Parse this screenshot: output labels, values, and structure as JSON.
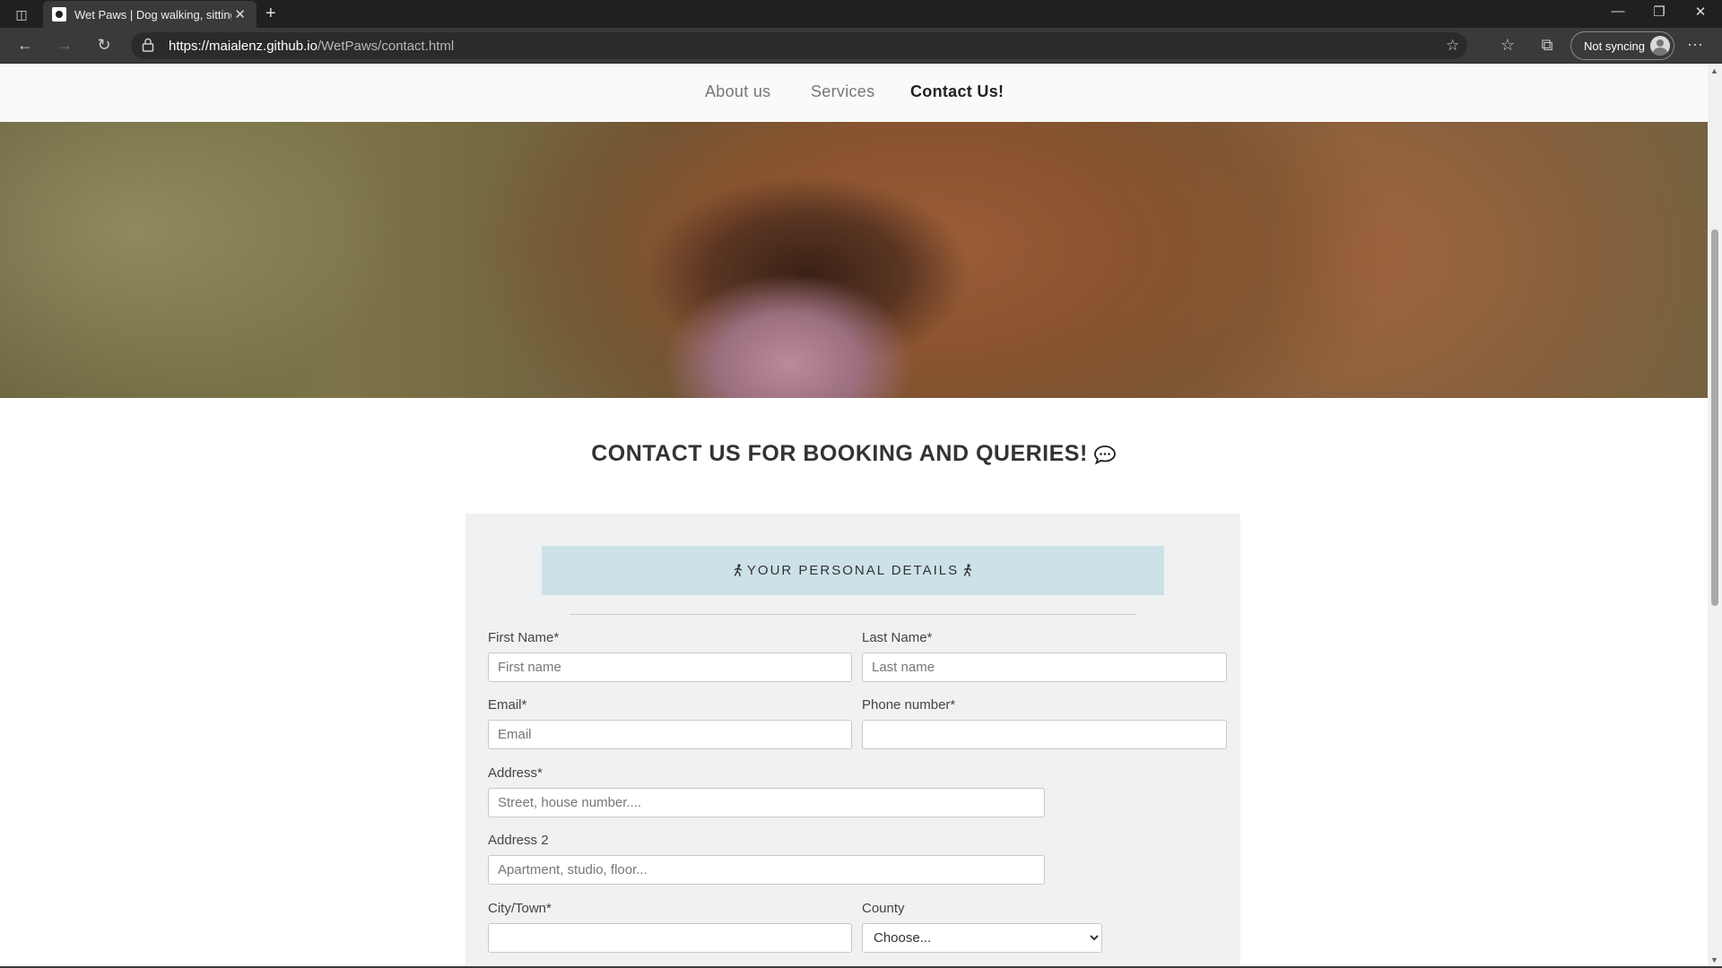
{
  "browser": {
    "tab_title": "Wet Paws | Dog walking, sitting",
    "url_host": "https://maialenz.github.io",
    "url_path": "/WetPaws/contact.html",
    "sync_label": "Not syncing"
  },
  "site_nav": {
    "items": [
      {
        "label": "About us"
      },
      {
        "label": "Services"
      },
      {
        "label": "Contact Us!"
      }
    ]
  },
  "heading": "CONTACT US FOR BOOKING AND QUERIES!",
  "form": {
    "section_title": "YOUR PERSONAL DETAILS",
    "first_name": {
      "label": "First Name*",
      "placeholder": "First name"
    },
    "last_name": {
      "label": "Last Name*",
      "placeholder": "Last name"
    },
    "email": {
      "label": "Email*",
      "placeholder": "Email"
    },
    "phone": {
      "label": "Phone number*",
      "placeholder": ""
    },
    "address": {
      "label": "Address*",
      "placeholder": "Street, house number...."
    },
    "address2": {
      "label": "Address 2",
      "placeholder": "Apartment, studio, floor..."
    },
    "city": {
      "label": "City/Town*",
      "placeholder": ""
    },
    "county": {
      "label": "County",
      "selected": "Choose..."
    }
  },
  "colors": {
    "banner_bg": "#cde1e8",
    "panel_bg": "#f0f1f2",
    "nav_active": "#222222"
  }
}
